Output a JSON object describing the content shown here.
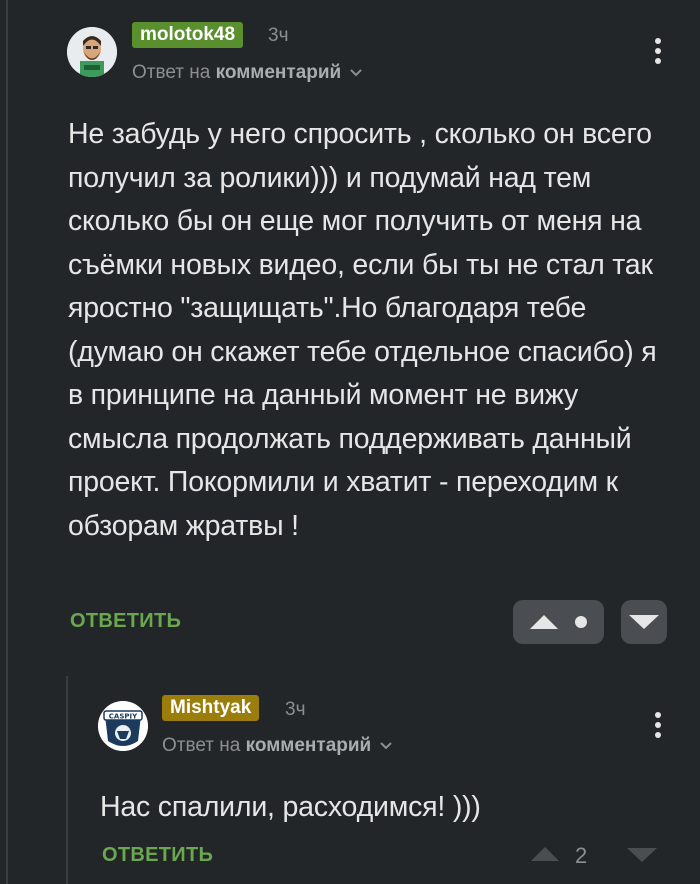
{
  "comments": [
    {
      "username": "molotok48",
      "username_color": "#5a8f2e",
      "time": "3ч",
      "reply_prefix": "Ответ на",
      "reply_target": "комментарий",
      "text": "Не забудь у него спросить , сколько он всего получил за ролики))) и подумай над тем сколько бы он еще мог получить от меня на съёмки новых видео, если бы ты не стал так яростно \"защищать\".Но благодаря тебе (думаю он скажет тебе отдельное спасибо) я в принципе на данный момент не вижу смысла продолжать поддерживать данный проект. Покормили и хватит - переходим к обзорам жратвы !",
      "reply_label": "ОТВЕТИТЬ",
      "avatar_icon": "man-avatar-icon"
    },
    {
      "username": "Mishtyak",
      "username_color": "#9a7d0a",
      "time": "3ч",
      "reply_prefix": "Ответ на",
      "reply_target": "комментарий",
      "text": "Нас спалили, расходимся! )))",
      "reply_label": "ОТВЕТИТЬ",
      "score": "2",
      "avatar_icon": "caspiy-logo-avatar-icon",
      "avatar_logo_text": "CASPIY"
    }
  ],
  "colors": {
    "background": "#232629",
    "accent_green": "#6aa84f"
  }
}
